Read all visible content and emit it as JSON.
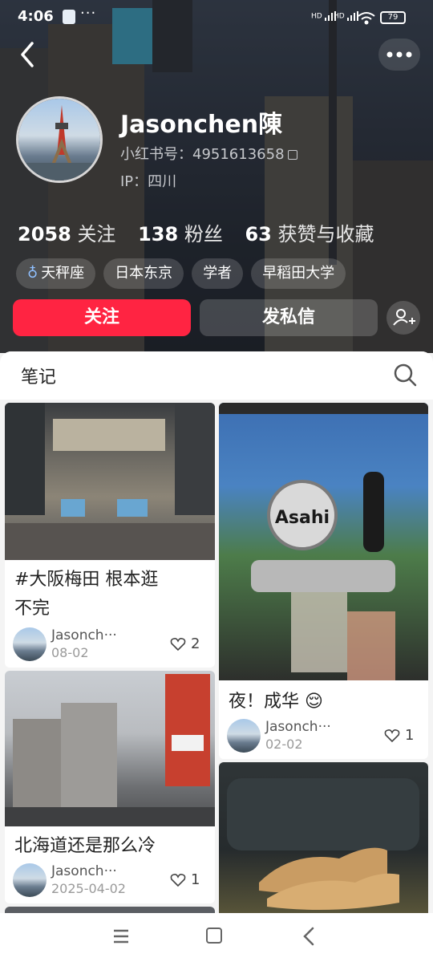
{
  "status_bar": {
    "time": "4:06",
    "dots": "···",
    "signal_1": "HD",
    "signal_2": "HD",
    "battery": "79"
  },
  "profile": {
    "name": "Jasonchen陳",
    "red_id_label": "小红书号：4951613658",
    "ip_label": "IP：四川",
    "stats": [
      {
        "num": "2058",
        "label": "关注"
      },
      {
        "num": "138",
        "label": "粉丝"
      },
      {
        "num": "63",
        "label": "获赞与收藏"
      }
    ],
    "tags": [
      "天秤座",
      "日本东京",
      "学者",
      "早稻田大学"
    ],
    "tag_icon": "♁"
  },
  "actions": {
    "follow": "关注",
    "message": "发私信"
  },
  "tabs": {
    "notes": "笔记"
  },
  "notes": [
    {
      "title_line1": "#大阪梅田 根本逛",
      "title_line2": "不完",
      "author": "Jasonch···",
      "date": "08-02",
      "likes": "2"
    },
    {
      "title_line1": "夜！成华 😌",
      "title_line2": "",
      "author": "Jasonch···",
      "date": "02-02",
      "likes": "1"
    },
    {
      "title_line1": "北海道还是那么冷",
      "title_line2": "",
      "author": "Jasonch···",
      "date": "2025-04-02",
      "likes": "1"
    }
  ],
  "colors": {
    "accent": "#ff2442",
    "header_bg": "#2b313b"
  }
}
